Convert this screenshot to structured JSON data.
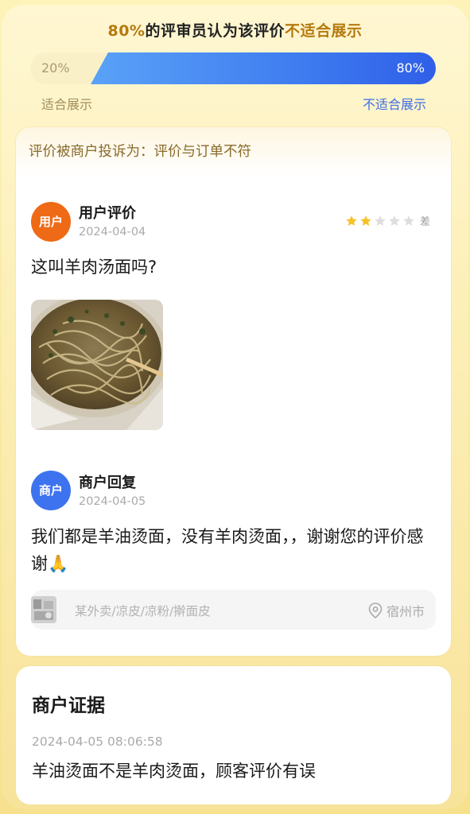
{
  "verdict": {
    "percent": "80%",
    "middle": "的评审员认为该评价",
    "highlight": "不适合展示"
  },
  "vote_bar": {
    "left_percent_label": "20%",
    "right_percent_label": "80%",
    "left_fraction": 0.2,
    "right_fraction": 0.8,
    "left_caption": "适合展示",
    "right_caption": "不适合展示",
    "left_color": "#faf0c8",
    "right_color": "#3f7cf0"
  },
  "review_card": {
    "complaint": "评价被商户投诉为：评价与订单不符",
    "user_review": {
      "avatar_label": "用户",
      "title": "用户评价",
      "date": "2024-04-04",
      "rating": 2,
      "rating_max": 5,
      "rating_text": "差",
      "text": "这叫羊肉汤面吗?",
      "photo": "noodle-soup-photo"
    },
    "merchant_reply": {
      "avatar_label": "商户",
      "title": "商户回复",
      "date": "2024-04-05",
      "text": "我们都是羊油烫面，没有羊肉烫面，，谢谢您的评价感谢",
      "emoji": "🙏"
    },
    "shop": {
      "name": "某外卖/凉皮/凉粉/擀面皮",
      "location": "宿州市",
      "location_icon": "location-pin-icon"
    }
  },
  "evidence_card": {
    "title": "商户证据",
    "timestamp": "2024-04-05 08:06:58",
    "text": "羊油烫面不是羊肉烫面，顾客评价有误"
  }
}
